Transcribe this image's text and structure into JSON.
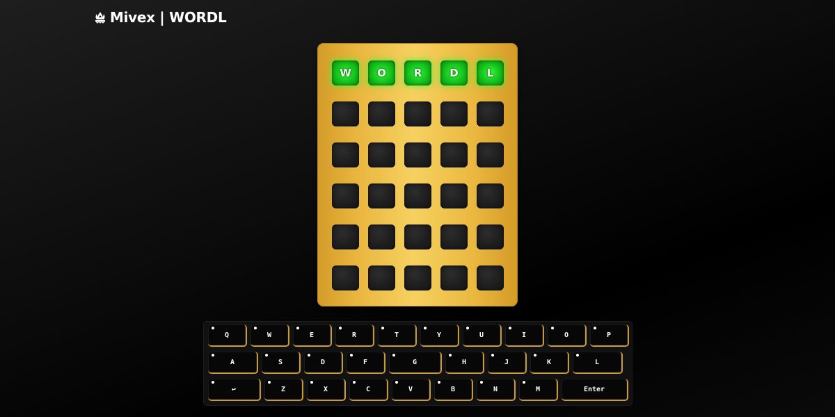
{
  "brand": {
    "title": "Mivex | WORDL",
    "icon": "flame-logo-icon"
  },
  "board": {
    "rows": [
      [
        "W",
        "O",
        "R",
        "D",
        "L"
      ],
      [
        "",
        "",
        "",
        "",
        ""
      ],
      [
        "",
        "",
        "",
        "",
        ""
      ],
      [
        "",
        "",
        "",
        "",
        ""
      ],
      [
        "",
        "",
        "",
        "",
        ""
      ],
      [
        "",
        "",
        "",
        "",
        ""
      ]
    ],
    "lit_rows": [
      0
    ],
    "lit_color": "#22e02a",
    "frame_color": "#f0c14b"
  },
  "keyboard": {
    "rows": [
      [
        "Q",
        "W",
        "E",
        "R",
        "T",
        "Y",
        "U",
        "I",
        "O",
        "P"
      ],
      [
        "A",
        "S",
        "D",
        "F",
        "G",
        "H",
        "J",
        "K",
        "L"
      ],
      [
        "↩",
        "Z",
        "X",
        "C",
        "V",
        "B",
        "N",
        "M",
        "Enter"
      ]
    ],
    "accent_color": "#c99a3c"
  }
}
